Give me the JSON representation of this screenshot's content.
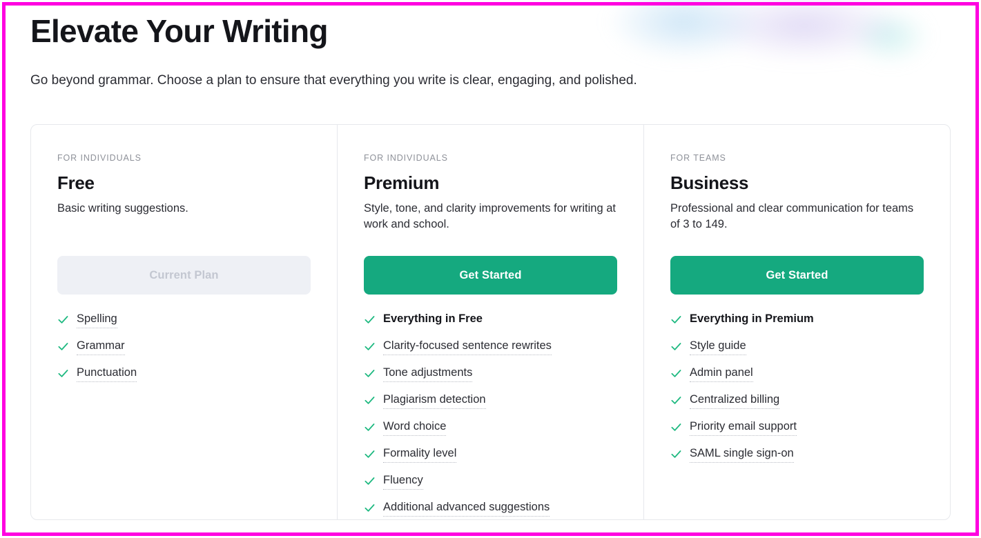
{
  "header": {
    "title": "Elevate Your Writing",
    "subtitle": "Go beyond grammar. Choose a plan to ensure that everything you write is clear, engaging, and polished."
  },
  "theme": {
    "accent_green": "#15a97f",
    "check_green": "#1eb980",
    "text_dark": "#14151a",
    "text_body": "#2b2c33",
    "eyebrow_gray": "#8e9199",
    "disabled_bg": "#eef0f5",
    "disabled_text": "#c3c7d1",
    "border": "#e6e8ec",
    "annotation": "#ff00e0"
  },
  "plans": [
    {
      "eyebrow": "FOR INDIVIDUALS",
      "name": "Free",
      "description": "Basic writing suggestions.",
      "cta": {
        "label": "Current Plan",
        "state": "disabled"
      },
      "features": [
        {
          "label": "Spelling",
          "bold": false
        },
        {
          "label": "Grammar",
          "bold": false
        },
        {
          "label": "Punctuation",
          "bold": false
        }
      ]
    },
    {
      "eyebrow": "FOR INDIVIDUALS",
      "name": "Premium",
      "description": "Style, tone, and clarity improvements for writing at work and school.",
      "cta": {
        "label": "Get Started",
        "state": "primary"
      },
      "features": [
        {
          "label": "Everything in Free",
          "bold": true
        },
        {
          "label": "Clarity-focused sentence rewrites",
          "bold": false
        },
        {
          "label": "Tone adjustments",
          "bold": false
        },
        {
          "label": "Plagiarism detection",
          "bold": false
        },
        {
          "label": "Word choice",
          "bold": false
        },
        {
          "label": "Formality level",
          "bold": false
        },
        {
          "label": "Fluency",
          "bold": false
        },
        {
          "label": "Additional advanced suggestions",
          "bold": false
        }
      ]
    },
    {
      "eyebrow": "FOR TEAMS",
      "name": "Business",
      "description": "Professional and clear communication for teams of 3 to 149.",
      "cta": {
        "label": "Get Started",
        "state": "primary"
      },
      "features": [
        {
          "label": "Everything in Premium",
          "bold": true
        },
        {
          "label": "Style guide",
          "bold": false
        },
        {
          "label": "Admin panel",
          "bold": false
        },
        {
          "label": "Centralized billing",
          "bold": false
        },
        {
          "label": "Priority email support",
          "bold": false
        },
        {
          "label": "SAML single sign-on",
          "bold": false
        }
      ]
    }
  ]
}
